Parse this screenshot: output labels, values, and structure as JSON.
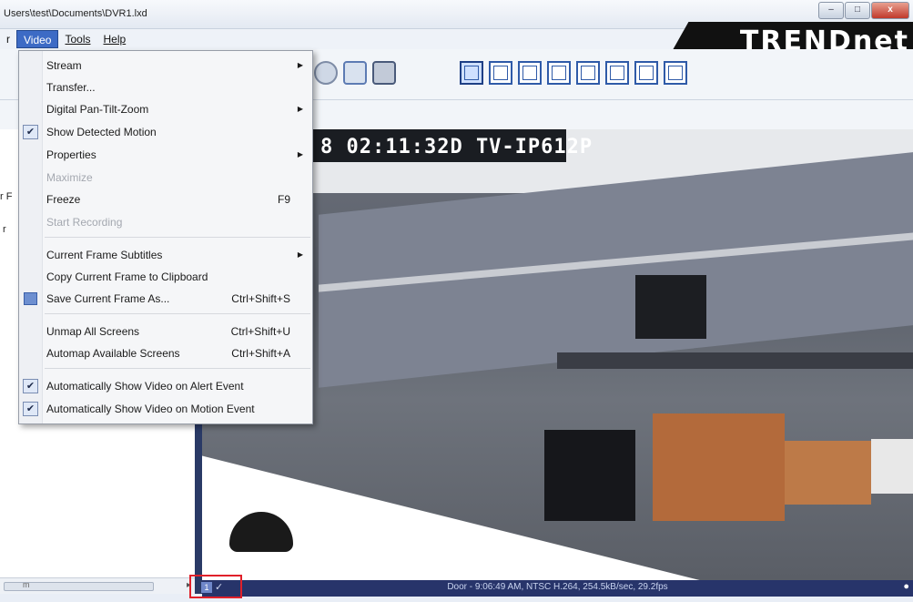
{
  "window": {
    "title_path": "Users\\test\\Documents\\DVR1.lxd",
    "controls": {
      "minimize": "–",
      "maximize": "□",
      "close": "x"
    }
  },
  "brand": {
    "logo_text": "TRENDnet"
  },
  "menubar": {
    "items": [
      {
        "label": "r"
      },
      {
        "label": "Video"
      },
      {
        "label": "Tools"
      },
      {
        "label": "Help"
      }
    ]
  },
  "video_menu": {
    "items": [
      {
        "label": "Stream",
        "submenu": true
      },
      {
        "label": "Transfer..."
      },
      {
        "label": "Digital Pan-Tilt-Zoom",
        "submenu": true
      },
      {
        "label": "Show Detected Motion",
        "checked": true
      },
      {
        "label": "Properties",
        "submenu": true
      },
      {
        "label": "Maximize",
        "disabled": true
      },
      {
        "label": "Freeze",
        "shortcut": "F9"
      },
      {
        "label": "Start Recording",
        "disabled": true
      },
      {
        "label": "Current Frame Subtitles",
        "submenu": true
      },
      {
        "label": "Copy Current Frame to Clipboard"
      },
      {
        "label": "Save Current Frame As...",
        "shortcut": "Ctrl+Shift+S"
      },
      {
        "label": "Unmap All Screens",
        "shortcut": "Ctrl+Shift+U"
      },
      {
        "label": "Automap Available Screens",
        "shortcut": "Ctrl+Shift+A"
      },
      {
        "label": "Automatically Show Video on Alert Event",
        "checked": true
      },
      {
        "label": "Automatically Show Video on Motion Event",
        "checked": true
      }
    ]
  },
  "video": {
    "overlay_text": "8 02:11:32D TV-IP612P"
  },
  "statusbar": {
    "screen_number": "1",
    "check": "✓",
    "text": "Door - 9:06:49 AM, NTSC H.264, 254.5kB/sec, 29.2fps",
    "scroll_label": "m",
    "scroll_arrow": "▸"
  },
  "left_panel": {
    "fragments": [
      "r F",
      "r"
    ]
  },
  "colors": {
    "accent": "#3d6bc5",
    "status_bg": "#27346a",
    "highlight_box": "#e0202a"
  }
}
